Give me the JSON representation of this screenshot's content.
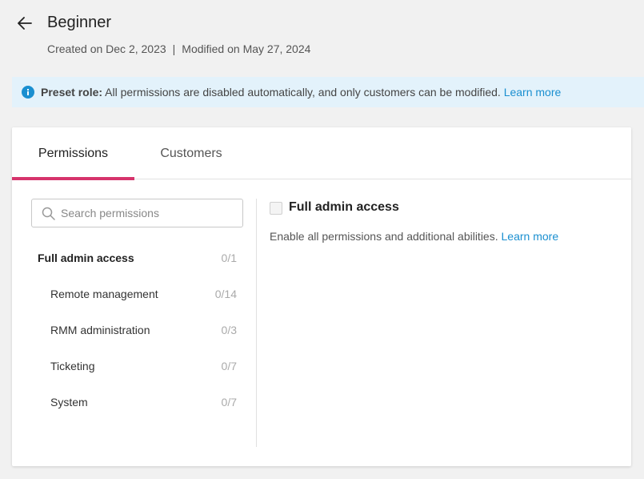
{
  "header": {
    "title": "Beginner",
    "created": "Created on Dec 2, 2023",
    "separator": "|",
    "modified": "Modified on May 27, 2024"
  },
  "banner": {
    "label": "Preset role:",
    "text": " All permissions are disabled automatically, and only customers can be modified. ",
    "link": "Learn more"
  },
  "tabs": [
    {
      "label": "Permissions",
      "active": true
    },
    {
      "label": "Customers",
      "active": false
    }
  ],
  "search": {
    "placeholder": "Search permissions",
    "value": ""
  },
  "permissions": [
    {
      "label": "Full admin access",
      "count": "0/1"
    },
    {
      "label": "Remote management",
      "count": "0/14"
    },
    {
      "label": "RMM administration",
      "count": "0/3"
    },
    {
      "label": "Ticketing",
      "count": "0/7"
    },
    {
      "label": "System",
      "count": "0/7"
    }
  ],
  "detail": {
    "title": "Full admin access",
    "checked": false,
    "description": "Enable all permissions and additional abilities. ",
    "link": "Learn more"
  },
  "colors": {
    "accent": "#d6336c",
    "link": "#1a8fd0",
    "banner_bg": "#e3f2fb",
    "info_icon": "#1a8fd0"
  },
  "icons": {
    "back": "arrow-left-icon",
    "info": "info-icon",
    "search": "search-icon"
  }
}
